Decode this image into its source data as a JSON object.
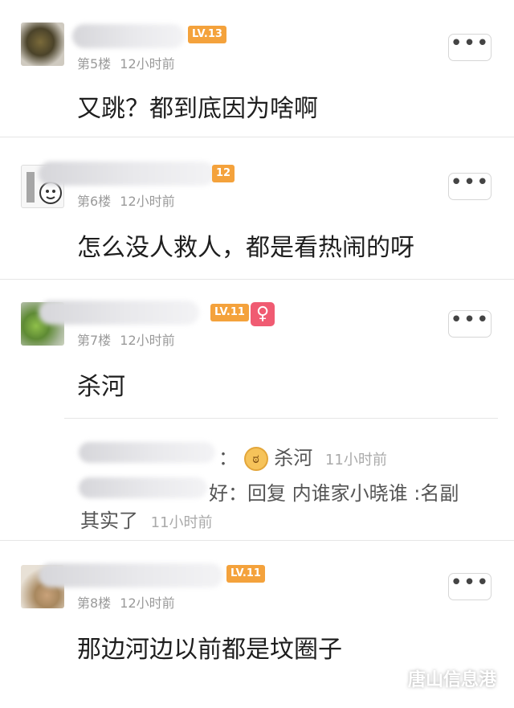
{
  "posts": [
    {
      "floor": "第5楼",
      "time": "12小时前",
      "level": "LV.13",
      "content": "又跳？都到底因为啥啊",
      "more_icon": "•••"
    },
    {
      "floor": "第6楼",
      "time": "12小时前",
      "level": "12",
      "content": "怎么没人救人，都是看热闹的呀",
      "more_icon": "•••"
    },
    {
      "floor": "第7楼",
      "time": "12小时前",
      "level": "LV.11",
      "gender_symbol": "♀",
      "content": "杀河",
      "more_icon": "•••"
    },
    {
      "floor": "第8楼",
      "time": "12小时前",
      "level": "LV.11",
      "content": "那边河边以前都是坟圈子",
      "more_icon": "•••"
    }
  ],
  "reply": {
    "line1_suffix": "：",
    "line1_text": "杀河",
    "line1_time": "11小时前",
    "line2_prefix": "好：",
    "line2_text": "回复 内谁家小晓谁 :名副",
    "line3_text": "其实了",
    "line3_time": "11小时前"
  },
  "watermark": {
    "text": "唐山信息港"
  }
}
